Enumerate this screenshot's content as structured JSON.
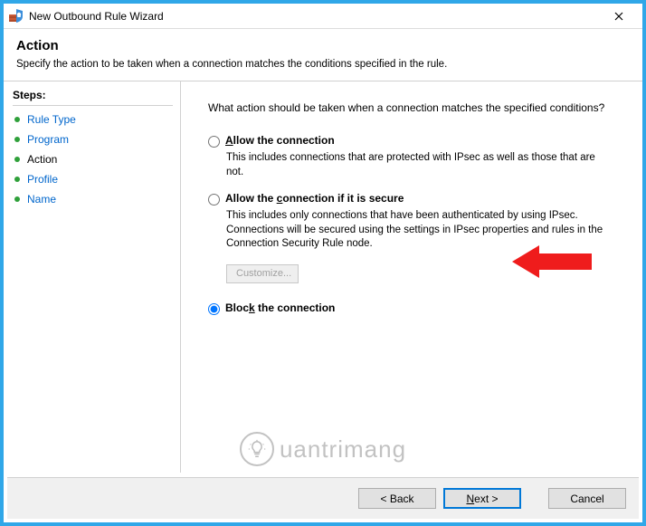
{
  "window": {
    "title": "New Outbound Rule Wizard"
  },
  "header": {
    "title": "Action",
    "subtitle": "Specify the action to be taken when a connection matches the conditions specified in the rule."
  },
  "sidebar": {
    "heading": "Steps:",
    "items": [
      {
        "label": "Rule Type",
        "state": "link"
      },
      {
        "label": "Program",
        "state": "link"
      },
      {
        "label": "Action",
        "state": "current"
      },
      {
        "label": "Profile",
        "state": "link"
      },
      {
        "label": "Name",
        "state": "link"
      }
    ]
  },
  "content": {
    "question": "What action should be taken when a connection matches the specified conditions?",
    "options": [
      {
        "id": "allow",
        "accel": "A",
        "label_rest": "llow the connection",
        "desc": "This includes connections that are protected with IPsec as well as those that are not.",
        "checked": false
      },
      {
        "id": "allow_secure",
        "prefix": "Allow the ",
        "accel": "c",
        "label_rest": "onnection if it is secure",
        "desc": "This includes only connections that have been authenticated by using IPsec. Connections will be secured using the settings in IPsec properties and rules in the Connection Security Rule node.",
        "checked": false,
        "customize_label": "Customize..."
      },
      {
        "id": "block",
        "prefix": "Bloc",
        "accel": "k",
        "label_rest": " the connection",
        "desc": "",
        "checked": true
      }
    ]
  },
  "buttons": {
    "back": "< Back",
    "next": "Next >",
    "cancel": "Cancel"
  },
  "watermark": {
    "text": "uantrimang"
  }
}
